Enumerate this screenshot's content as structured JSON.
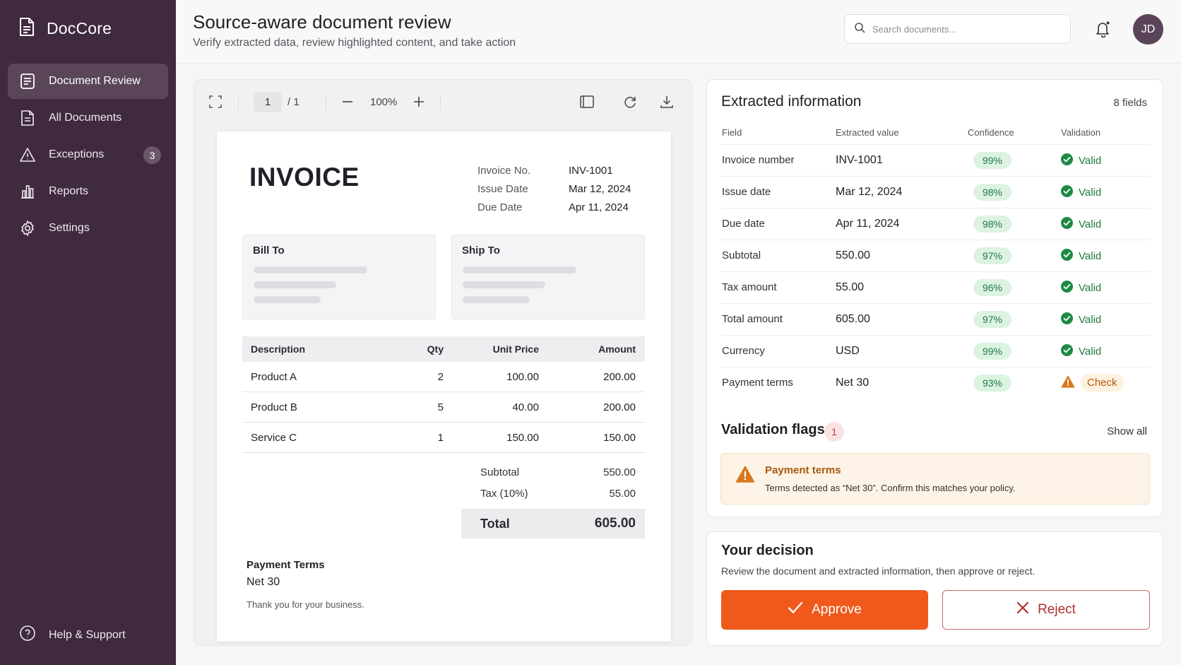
{
  "app": {
    "name": "DocCore"
  },
  "sidebar": {
    "items": [
      {
        "label": "Document Review",
        "icon": "document-review-icon",
        "active": true
      },
      {
        "label": "All Documents",
        "icon": "documents-icon"
      },
      {
        "label": "Exceptions",
        "icon": "warning-icon",
        "badge": "3"
      },
      {
        "label": "Reports",
        "icon": "bar-chart-icon"
      },
      {
        "label": "Settings",
        "icon": "gear-icon"
      }
    ],
    "help_label": "Help & Support"
  },
  "header": {
    "title": "Source-aware document review",
    "subtitle": "Verify extracted data, review highlighted content, and take action",
    "search_placeholder": "Search documents...",
    "avatar_initials": "JD"
  },
  "viewer": {
    "page_current": "1",
    "page_total": "/ 1",
    "zoom": "100%"
  },
  "invoice": {
    "title": "INVOICE",
    "meta": [
      {
        "label": "Invoice No.",
        "value": "INV-1001"
      },
      {
        "label": "Issue Date",
        "value": "Mar 12, 2024"
      },
      {
        "label": "Due Date",
        "value": "Apr 11, 2024"
      }
    ],
    "bill_to": "Bill To",
    "ship_to": "Ship To",
    "columns": [
      "Description",
      "Qty",
      "Unit Price",
      "Amount"
    ],
    "rows": [
      {
        "desc": "Product A",
        "qty": "2",
        "unit": "100.00",
        "amount": "200.00"
      },
      {
        "desc": "Product B",
        "qty": "5",
        "unit": "40.00",
        "amount": "200.00"
      },
      {
        "desc": "Service C",
        "qty": "1",
        "unit": "150.00",
        "amount": "150.00"
      }
    ],
    "subtotal_label": "Subtotal",
    "subtotal": "550.00",
    "tax_label": "Tax (10%)",
    "tax": "55.00",
    "total_label": "Total",
    "total": "605.00",
    "payment_terms_label": "Payment Terms",
    "payment_terms": "Net 30",
    "thanks": "Thank you for your business."
  },
  "extracted": {
    "title": "Extracted information",
    "count": "8 fields",
    "columns": [
      "Field",
      "Extracted value",
      "Confidence",
      "Validation"
    ],
    "rows": [
      {
        "field": "Invoice number",
        "value": "INV-1001",
        "confidence": "99%",
        "status": "Valid"
      },
      {
        "field": "Issue date",
        "value": "Mar 12, 2024",
        "confidence": "98%",
        "status": "Valid"
      },
      {
        "field": "Due date",
        "value": "Apr 11, 2024",
        "confidence": "98%",
        "status": "Valid"
      },
      {
        "field": "Subtotal",
        "value": "550.00",
        "confidence": "97%",
        "status": "Valid"
      },
      {
        "field": "Tax amount",
        "value": "55.00",
        "confidence": "96%",
        "status": "Valid"
      },
      {
        "field": "Total amount",
        "value": "605.00",
        "confidence": "97%",
        "status": "Valid"
      },
      {
        "field": "Currency",
        "value": "USD",
        "confidence": "99%",
        "status": "Valid"
      },
      {
        "field": "Payment terms",
        "value": "Net 30",
        "confidence": "93%",
        "status": "Check"
      }
    ]
  },
  "flags": {
    "title": "Validation flags",
    "count": "1",
    "show_all": "Show all",
    "items": [
      {
        "title": "Payment terms",
        "detail": "Terms detected as “Net 30”. Confirm this matches your policy."
      }
    ]
  },
  "decision": {
    "title": "Your decision",
    "subtitle": "Review the document and extracted information, then approve or reject.",
    "approve_label": "Approve",
    "reject_label": "Reject"
  },
  "colors": {
    "sidebar_bg": "#3f2a3f",
    "approve": "#f0591c",
    "reject": "#b32f2f",
    "valid": "#1e7a3e",
    "warning": "#d9781c"
  }
}
